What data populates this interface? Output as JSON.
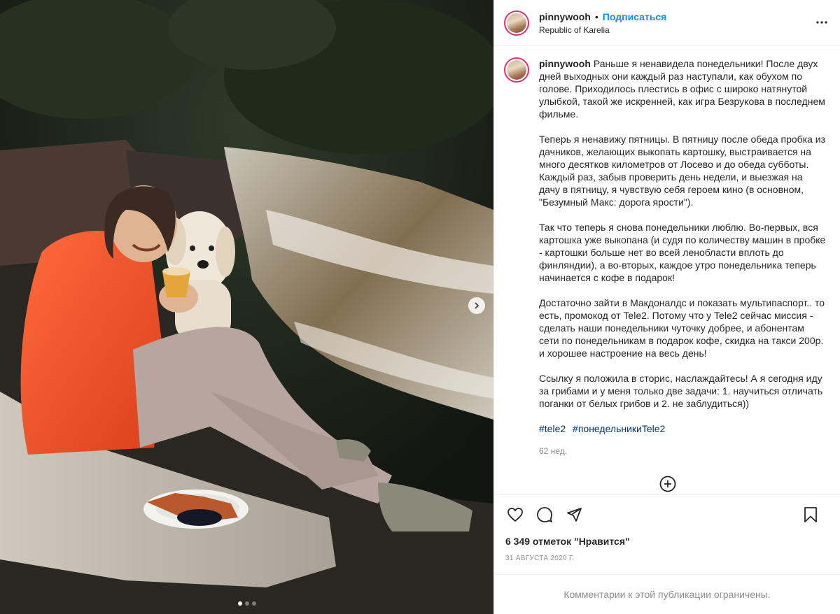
{
  "header": {
    "username": "pinnywooh",
    "separator": "•",
    "follow_label": "Подписаться",
    "location": "Republic of Karelia",
    "more_icon": "ellipsis-icon"
  },
  "caption": {
    "username": "pinnywooh",
    "paragraphs": [
      "Раньше я ненавидела понедельники! После двух дней выходных они каждый раз наступали, как обухом по голове. Приходилось плестись в офис с широко натянутой улыбкой, такой же искренней, как игра Безрукова в последнем фильме.",
      "Теперь я ненавижу пятницы. В пятницу после обеда пробка из дачников, желающих выкопать картошку, выстраивается на много десятков километров от Лосево и до обеда субботы. Каждый раз, забыв проверить день недели, и выезжая на дачу в пятницу, я чувствую себя героем кино (в основном, \"Безумный Макс: дорога ярости\").",
      "Так что теперь я снова понедельники люблю. Во-первых, вся картошка уже выкопана (и судя по количеству машин в пробке - картошки больше нет во всей ленобласти вплоть до финляндии), а во-вторых, каждое утро понедельника теперь начинается с кофе в подарок!",
      "Достаточно зайти в Макдоналдс и показать мультипаспорт.. то есть, промокод от Tele2. Потому что у Tele2 сейчас миссия - сделать наши понедельники чуточку добрее, и абонентам сети по понедельникам в подарок кофе, скидка на такси 200р. и хорошее настроение на весь день!",
      "Ссылку я положила в сторис, наслаждайтесь! А я сегодня иду за грибами и у меня только две задачи: 1. научиться отличать поганки от белых грибов и 2. не заблудиться))"
    ],
    "hashtags": [
      "#tele2",
      "#понедельникиTele2"
    ],
    "time_ago": "62 нед."
  },
  "actions": {
    "like_icon": "heart-icon",
    "comment_icon": "comment-icon",
    "share_icon": "paper-plane-icon",
    "save_icon": "bookmark-icon",
    "load_more_icon": "plus-circle-icon"
  },
  "likes_text": "6 349 отметок \"Нравится\"",
  "date_text": "31 АВГУСТА 2020 Г.",
  "comments_restricted": "Комментарии к этой публикации ограничены.",
  "carousel": {
    "current": 1,
    "total": 3,
    "next_icon": "chevron-right-icon"
  }
}
